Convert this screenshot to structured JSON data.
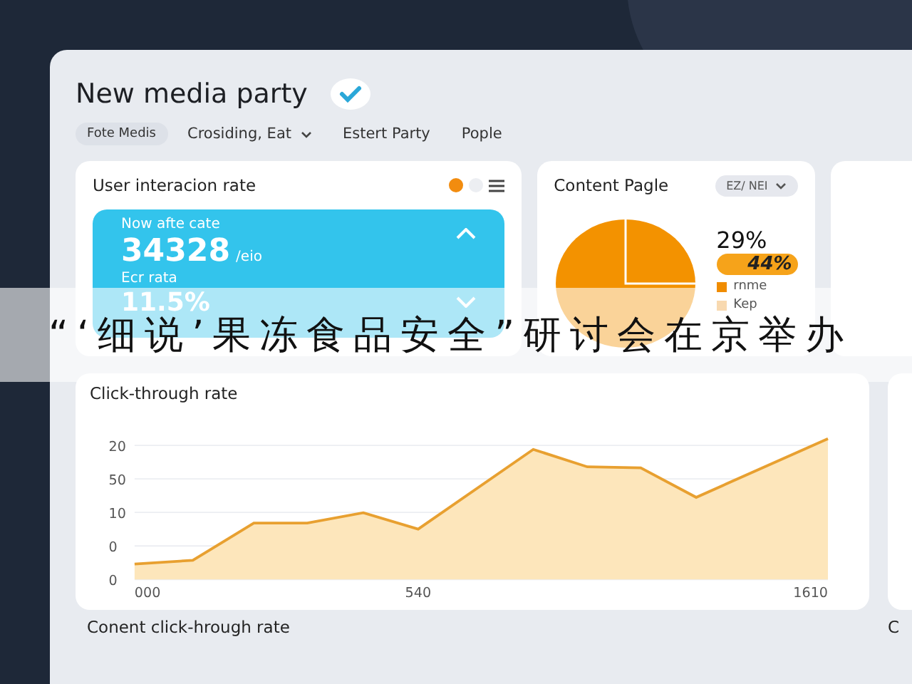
{
  "header": {
    "title": "New media party",
    "verified": true
  },
  "tabs": [
    {
      "label": "Fote Medis",
      "selected": true,
      "dropdown": false
    },
    {
      "label": "Crosiding, Eat",
      "selected": false,
      "dropdown": true
    },
    {
      "label": "Estert Party",
      "selected": false,
      "dropdown": false
    },
    {
      "label": "Pople",
      "selected": false,
      "dropdown": false
    }
  ],
  "interaction_card": {
    "title": "User interacion rate",
    "pager": [
      {
        "selected": true
      },
      {
        "selected": false
      }
    ],
    "stat": {
      "label": "Now afte cate",
      "value": "34328",
      "unit": "/eio",
      "sub_label": "Ecr rata",
      "sub_value": "11.5%"
    }
  },
  "content_card": {
    "title": "Content Pagle",
    "dropdown": "EZ/ NEI",
    "percent": "29%",
    "badge": "44%",
    "legend": [
      {
        "label": "rnme",
        "color": "#f08c00"
      },
      {
        "label": "Kep",
        "color": "#f8d9b0"
      }
    ]
  },
  "chart_card": {
    "title": "Click-through rate",
    "y_axis_labels": [
      "20",
      "50",
      "10",
      "0",
      "0"
    ],
    "x_axis_labels": [
      "000",
      "540",
      "1610"
    ]
  },
  "captions": [
    "Conent click-hrough rate",
    "C"
  ],
  "banner": {
    "text": "“‘细说’果冻食品安全”研讨会在京举办"
  }
}
